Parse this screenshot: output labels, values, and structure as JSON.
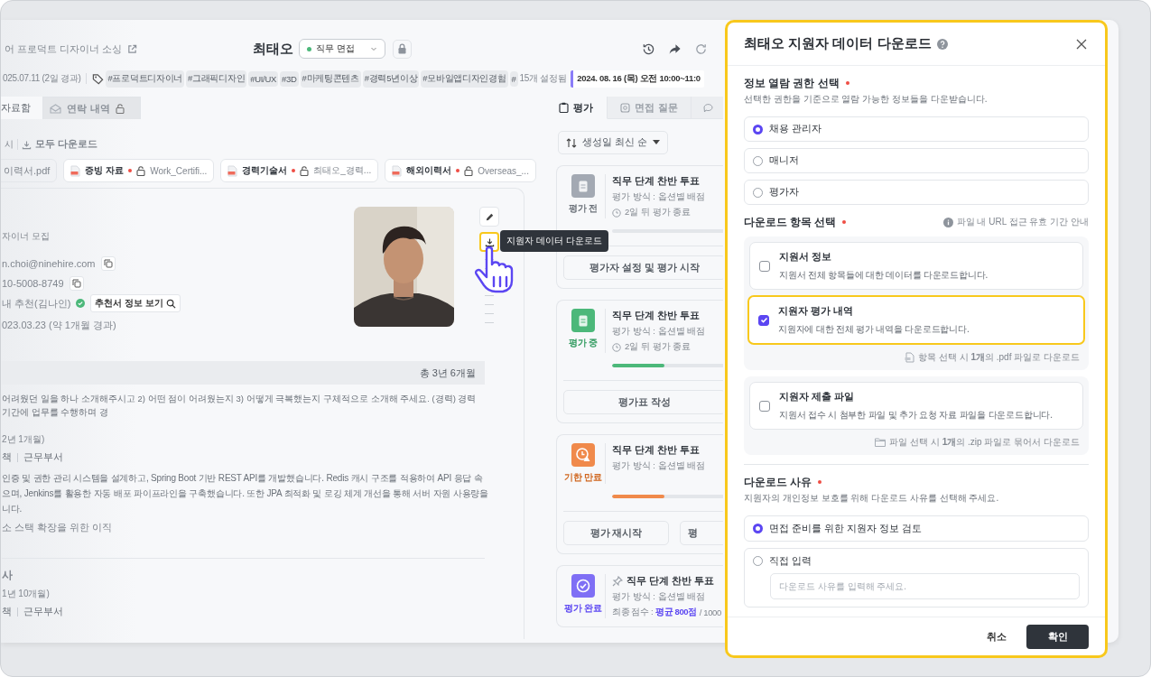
{
  "app": {
    "header": {
      "job_title": "어 프로덕트 디자이너 소싱",
      "candidate_name": "최태오",
      "stage": "직무 면접"
    },
    "info_bar": {
      "applied_date": "025.07.11 (2일 경과)",
      "tags": [
        "#프로덕트디자이너",
        "#그래픽디자인",
        "#UI/UX",
        "#3D",
        "#마케팅콘텐츠",
        "#경력5년이상",
        "#모바일앱디자인경험"
      ],
      "tag_overflow": "#",
      "tag_count": "15개 설정됨",
      "schedule": "2024. 08. 16 (목) 오전 10:00~11:0"
    },
    "left_tabs": [
      {
        "label": "자료함",
        "selected": true,
        "locked": false
      },
      {
        "label": "연락 내역",
        "selected": false,
        "locked": true
      }
    ],
    "files": {
      "label": "시",
      "download_all": "모두 다운로드",
      "items": [
        {
          "kind": "plain",
          "name": "이력서.pdf"
        },
        {
          "kind": "document",
          "type": "증빙 자료",
          "required": true,
          "locked": true,
          "name": "Work_Certifi..."
        },
        {
          "kind": "document",
          "type": "경력기술서",
          "required": true,
          "locked": true,
          "name": "최태오_경력..."
        },
        {
          "kind": "document",
          "type": "해외이력서",
          "required": true,
          "locked": true,
          "name": "Overseas_..."
        }
      ]
    },
    "profile": {
      "posting": "자이너 모집",
      "email": "n.choi@ninehire.com",
      "phone": "10-5008-8749",
      "referral": "내 추천(김나인)",
      "referral_verified": true,
      "referral_button": "추천서 정보 보기",
      "date": "023.03.23 (약 1개월 경과)",
      "download_highlighted": true,
      "tooltip": "지원자 데이터 다운로드"
    },
    "career": {
      "total": "총 3년 6개월",
      "question": "어려웠던 일을 하나 소개해주시고 2) 어떤 점이 어려웠는지 3) 어떻게 극복했는지 구체적으로 소개해 주세요. (경력) 경력 기간에 업무를 수행하며 경",
      "entries": [
        {
          "period": "2년 1개월)",
          "role": "책",
          "department": "근무부서",
          "description": "인증 및 권한 관리 시스템을 설계하고, Spring Boot 기반 REST API를 개발했습니다. Redis 캐시 구조를 적용하여 API 응답 속\n으며, Jenkins를 활용한 자동 배포 파이프라인을 구축했습니다. 또한 JPA 최적화 및 로깅 체계 개선을 통해 서버 자원 사용량을\n니다.",
          "reason": "소 스택 확장을 위한 이직"
        },
        {
          "company": "사",
          "period": "1년 10개월)",
          "role": "책",
          "department": "근무부서"
        }
      ]
    },
    "evaluation": {
      "tabs": [
        {
          "label": "평가",
          "selected": true
        },
        {
          "label": "면접 질문",
          "selected": false
        },
        {
          "selected": false
        }
      ],
      "sort": "생성일 최신 순",
      "cards": [
        {
          "kind": "before",
          "status_label": "평가 전",
          "pinned": false,
          "title": "직무 단계 찬반 투표",
          "method": "평가 방식 : 옵션별 배점",
          "deadline": "2일 뒤 평가 종료",
          "level": 0,
          "actions": [
            "평가자 설정 및 평가 시작"
          ]
        },
        {
          "kind": "ongoing",
          "status_label": "평가 중",
          "pinned": false,
          "title": "직무 단계 찬반 투표",
          "method": "평가 방식 : 옵션별 배점",
          "deadline": "2일 뒤 평가 종료",
          "level": 0.4,
          "actions": [
            "평가표 작성"
          ]
        },
        {
          "kind": "expired",
          "status_label": "기한 만료",
          "pinned": false,
          "title": "직무 단계 찬반 투표",
          "method": "평가 방식 : 옵션별 배점",
          "level": 0.4,
          "actions": [
            "평가 재시작",
            "평"
          ]
        },
        {
          "kind": "done",
          "status_label": "평가 완료",
          "pinned": true,
          "title": "직무 단계 찬반 투표",
          "method": "평가 방식 : 옵션별 배점",
          "score_label": "최종 점수 :",
          "score": "평균 800점",
          "score_total": "/ 1000"
        }
      ]
    }
  },
  "dialog": {
    "title": "최태오 지원자 데이터 다운로드",
    "permission": {
      "title": "정보 열람 권한 선택",
      "required": true,
      "description": "선택한 권한을 기준으로 열람 가능한 정보들을 다운받습니다.",
      "options": [
        {
          "label": "채용 관리자",
          "selected": true
        },
        {
          "label": "매니저",
          "selected": false
        },
        {
          "label": "평가자",
          "selected": false
        }
      ]
    },
    "items": {
      "title": "다운로드 항목 선택",
      "required": true,
      "help_link": "파일 내 URL 접근 유효 기간 안내",
      "groups": [
        {
          "kind": "pdf",
          "items": [
            {
              "title": "지원서 정보",
              "description": "지원서 전체 항목들에 대한 데이터를 다운로드합니다.",
              "checked": false,
              "highlighted": false
            },
            {
              "title": "지원자 평가 내역",
              "description": "지원자에 대한 전체 평가 내역을 다운로드합니다.",
              "checked": true,
              "highlighted": true
            }
          ],
          "note": "항목 선택 시 **1개**의 .pdf 파일로 다운로드"
        },
        {
          "kind": "zip",
          "items": [
            {
              "title": "지원자 제출 파일",
              "description": "지원서 접수 시 첨부한 파일 및 추가 요청 자료 파일을 다운로드합니다.",
              "checked": false,
              "highlighted": false
            }
          ],
          "note": "파일 선택 시 **1개**의 .zip 파일로 묶어서 다운로드"
        }
      ]
    },
    "reason": {
      "title": "다운로드 사유",
      "required": true,
      "description": "지원자의 개인정보 보호를 위해 다운로드 사유를 선택해 주세요.",
      "options": [
        {
          "label": "면접 준비를 위한 지원자 정보 검토",
          "selected": true
        },
        {
          "label": "직접 입력",
          "selected": false,
          "placeholder": "다운로드 사유를 입력해 주세요."
        }
      ]
    },
    "cancel": "취소",
    "confirm": "확인"
  }
}
